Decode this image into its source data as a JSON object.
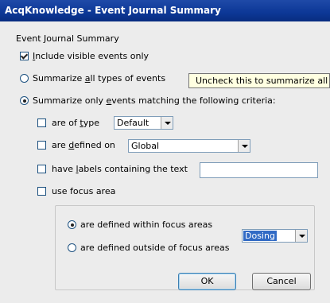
{
  "window": {
    "title": "AcqKnowledge - Event Journal Summary"
  },
  "section_title": "Event Journal Summary",
  "include_visible": {
    "label_pre": "",
    "label_key": "I",
    "label_post": "nclude visible events only",
    "checked": true
  },
  "summarize_all": {
    "label_pre": "Summarize ",
    "label_key": "a",
    "label_post": "ll types of events",
    "selected": false
  },
  "tooltip": {
    "text": "Uncheck this to summarize all of"
  },
  "summarize_matching": {
    "label_pre": "Summarize only ",
    "label_key": "e",
    "label_post": "vents matching the following criteria:",
    "selected": true
  },
  "criteria": {
    "type": {
      "label_pre": "are of ",
      "label_key": "t",
      "label_post": "ype",
      "checked": false,
      "value": "Default"
    },
    "defined_on": {
      "label_pre": "are ",
      "label_key": "d",
      "label_post": "efined on",
      "checked": false,
      "value": "Global"
    },
    "labels": {
      "label_pre": "have ",
      "label_key": "l",
      "label_post": "abels containing the text",
      "checked": false,
      "value": ""
    },
    "focus": {
      "label": "use focus area",
      "checked": false
    }
  },
  "focus_options": {
    "within": {
      "label": "are defined within focus areas",
      "selected": true
    },
    "outside": {
      "label": "are defined outside of focus areas",
      "selected": false
    },
    "focus_value": "Dosing"
  },
  "buttons": {
    "ok": "OK",
    "cancel": "Cancel"
  }
}
